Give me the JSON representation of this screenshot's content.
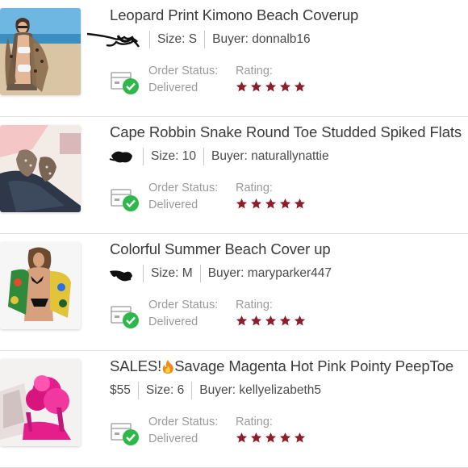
{
  "orders": [
    {
      "title": "Leopard Print Kimono Beach Coverup",
      "price_redacted": true,
      "size": "Size: S",
      "buyer": "Buyer: donnalb16",
      "status_label": "Order Status:",
      "status_value": "Delivered",
      "rating_label": "Rating:",
      "rating": 5,
      "image": "woman-in-white-bikini-and-leopard-kimono-on-beach"
    },
    {
      "title": "Cape Robbin Snake Round Toe Studded Spiked Flats",
      "price_redacted": true,
      "size": "Size: 10",
      "buyer": "Buyer: naturallynattie",
      "status_label": "Order Status:",
      "status_value": "Delivered",
      "rating_label": "Rating:",
      "rating": 5,
      "image": "snake-print-studded-flats-with-jeans"
    },
    {
      "title": "Colorful Summer Beach Cover up",
      "price_redacted": true,
      "size": "Size: M",
      "buyer": "Buyer: maryparker447",
      "status_label": "Order Status:",
      "status_value": "Delivered",
      "rating_label": "Rating:",
      "rating": 5,
      "image": "woman-in-black-bikini-and-colorful-cover-up"
    },
    {
      "title_prefix": "SALES!",
      "title_emoji": "fire-emoji",
      "title": "Savage Magenta Hot Pink Pointy PeepToe",
      "price": "$55",
      "size": "Size: 6",
      "buyer": "Buyer: kellyelizabeth5",
      "status_label": "Order Status:",
      "status_value": "Delivered",
      "rating_label": "Rating:",
      "rating": 5,
      "image": "hot-pink-fur-peep-toe-heels"
    }
  ],
  "colors": {
    "star": "#8b1e2a",
    "check": "#2eb84b",
    "divider": "#e2e2e2"
  }
}
